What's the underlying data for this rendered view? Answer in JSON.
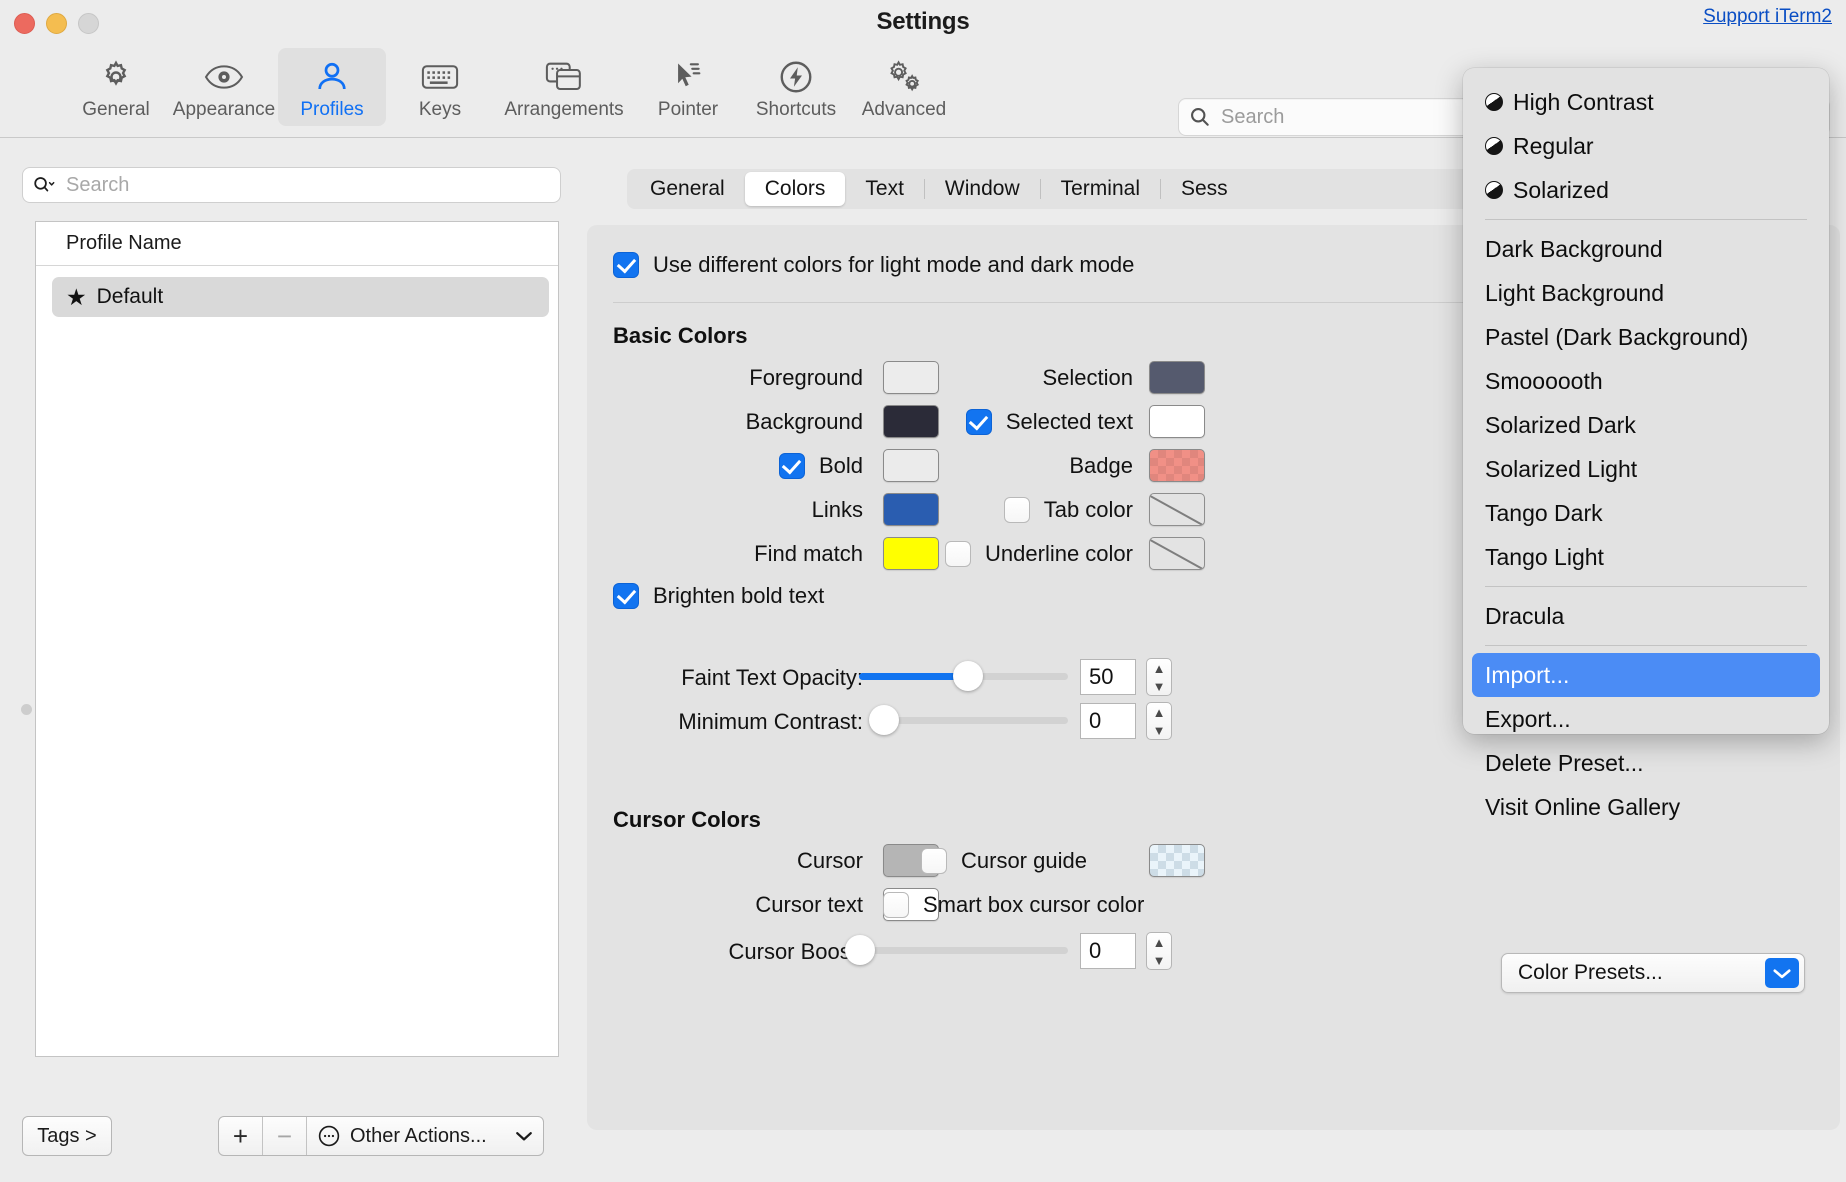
{
  "window": {
    "title": "Settings",
    "support_link": "Support iTerm2",
    "traffic_lights": [
      "close-red",
      "minimize-yellow",
      "zoom-gray"
    ]
  },
  "toolbar": {
    "items": [
      {
        "label": "General",
        "icon": "gear-icon",
        "selected": false
      },
      {
        "label": "Appearance",
        "icon": "eye-icon",
        "selected": false
      },
      {
        "label": "Profiles",
        "icon": "person-icon",
        "selected": true
      },
      {
        "label": "Keys",
        "icon": "keyboard-icon",
        "selected": false
      },
      {
        "label": "Arrangements",
        "icon": "windows-icon",
        "selected": false
      },
      {
        "label": "Pointer",
        "icon": "cursor-icon",
        "selected": false
      },
      {
        "label": "Shortcuts",
        "icon": "bolt-circle-icon",
        "selected": false
      },
      {
        "label": "Advanced",
        "icon": "gears-icon",
        "selected": false
      }
    ],
    "search_placeholder": "Search"
  },
  "sidebar": {
    "search_placeholder": "Search",
    "table_header": "Profile Name",
    "profiles": [
      {
        "name": "Default",
        "favorite": true,
        "selected": true
      }
    ],
    "tags_button": "Tags >",
    "add_button": "+",
    "remove_button": "−",
    "other_actions": "Other Actions..."
  },
  "tabs": [
    {
      "label": "General",
      "active": false
    },
    {
      "label": "Colors",
      "active": true
    },
    {
      "label": "Text",
      "active": false
    },
    {
      "label": "Window",
      "active": false
    },
    {
      "label": "Terminal",
      "active": false
    },
    {
      "label": "Sess",
      "active": false
    }
  ],
  "colors_panel": {
    "use_different_colors": {
      "label": "Use different colors for light mode and dark mode",
      "checked": true
    },
    "basic_colors_title": "Basic Colors",
    "left_rows": [
      {
        "label": "Foreground",
        "checkbox": null,
        "swatch": "#ececec",
        "swatch_type": "solid"
      },
      {
        "label": "Background",
        "checkbox": null,
        "swatch": "#2b2b38",
        "swatch_type": "solid"
      },
      {
        "label": "Bold",
        "checkbox": true,
        "swatch": "#ebebeb",
        "swatch_type": "solid"
      },
      {
        "label": "Links",
        "checkbox": null,
        "swatch": "#2a5db0",
        "swatch_type": "solid"
      },
      {
        "label": "Find match",
        "checkbox": null,
        "swatch": "#ffff00",
        "swatch_type": "solid"
      }
    ],
    "right_rows": [
      {
        "label": "Selection",
        "checkbox": null,
        "swatch": "#555a6e",
        "swatch_type": "solid"
      },
      {
        "label": "Selected text",
        "checkbox": true,
        "swatch": "#ffffff",
        "swatch_type": "solid"
      },
      {
        "label": "Badge",
        "checkbox": null,
        "swatch": "#f19086",
        "swatch_type": "checker-red"
      },
      {
        "label": "Tab color",
        "checkbox": false,
        "swatch": "",
        "swatch_type": "disabled"
      },
      {
        "label": "Underline color",
        "checkbox": false,
        "swatch": "",
        "swatch_type": "disabled"
      }
    ],
    "brighten_bold": {
      "label": "Brighten bold text",
      "checked": true
    },
    "sliders": [
      {
        "label": "Faint Text Opacity:",
        "value": "50",
        "percent": 50
      },
      {
        "label": "Minimum Contrast:",
        "value": "0",
        "percent": 0
      }
    ],
    "cursor_colors_title": "Cursor Colors",
    "cursor_left_rows": [
      {
        "label": "Cursor",
        "swatch": "#b5b5b5",
        "swatch_type": "solid"
      },
      {
        "label": "Cursor text",
        "swatch": "#ffffff",
        "swatch_type": "solid"
      }
    ],
    "cursor_right_rows": [
      {
        "label": "Cursor guide",
        "checkbox": false,
        "swatch": "#eaf4fa",
        "swatch_type": "checker-blue"
      },
      {
        "label": "Smart box cursor color",
        "checkbox": false,
        "swatch": null,
        "swatch_type": "none"
      }
    ],
    "cursor_boost": {
      "label": "Cursor Boost:",
      "value": "0",
      "percent": 0
    },
    "color_presets_button": "Color Presets..."
  },
  "presets_menu": {
    "groups": [
      {
        "items": [
          {
            "label": "High Contrast",
            "icon": "half-circle-icon",
            "highlighted": false
          },
          {
            "label": "Regular",
            "icon": "half-circle-icon",
            "highlighted": false
          },
          {
            "label": "Solarized",
            "icon": "half-circle-icon",
            "highlighted": false
          }
        ]
      },
      {
        "items": [
          {
            "label": "Dark Background",
            "icon": null,
            "highlighted": false
          },
          {
            "label": "Light Background",
            "icon": null,
            "highlighted": false
          },
          {
            "label": "Pastel (Dark Background)",
            "icon": null,
            "highlighted": false
          },
          {
            "label": "Smoooooth",
            "icon": null,
            "highlighted": false
          },
          {
            "label": "Solarized Dark",
            "icon": null,
            "highlighted": false
          },
          {
            "label": "Solarized Light",
            "icon": null,
            "highlighted": false
          },
          {
            "label": "Tango Dark",
            "icon": null,
            "highlighted": false
          },
          {
            "label": "Tango Light",
            "icon": null,
            "highlighted": false
          }
        ]
      },
      {
        "items": [
          {
            "label": "Dracula",
            "icon": null,
            "highlighted": false
          }
        ]
      },
      {
        "items": [
          {
            "label": "Import...",
            "icon": null,
            "highlighted": true
          },
          {
            "label": "Export...",
            "icon": null,
            "highlighted": false
          },
          {
            "label": "Delete Preset...",
            "icon": null,
            "highlighted": false
          },
          {
            "label": "Visit Online Gallery",
            "icon": null,
            "highlighted": false
          }
        ]
      }
    ]
  },
  "accent_color": "#1274f0"
}
